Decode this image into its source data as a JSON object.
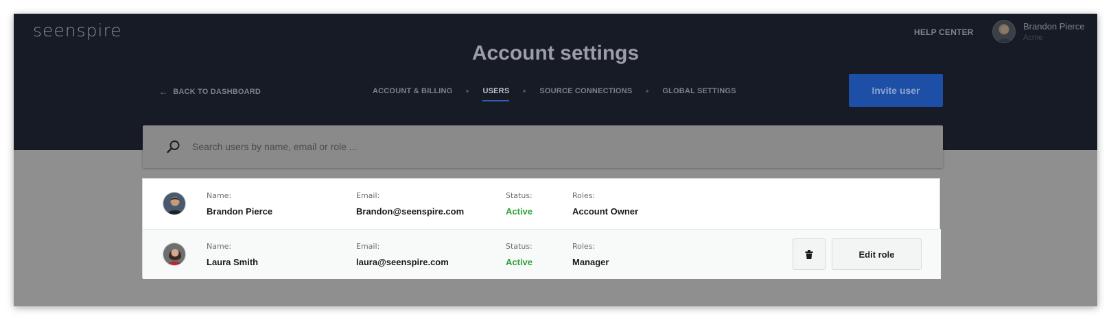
{
  "brand": {
    "logo_text": "seenspire"
  },
  "header": {
    "help_center": "HELP CENTER",
    "profile": {
      "name": "Brandon Pierce",
      "org": "Acme"
    }
  },
  "page": {
    "title": "Account settings"
  },
  "nav": {
    "back_label": "BACK TO DASHBOARD",
    "tabs": [
      {
        "label": "ACCOUNT & BILLING",
        "active": false
      },
      {
        "label": "USERS",
        "active": true
      },
      {
        "label": "SOURCE CONNECTIONS",
        "active": false
      },
      {
        "label": "GLOBAL SETTINGS",
        "active": false
      }
    ],
    "invite_label": "Invite user"
  },
  "search": {
    "placeholder": "Search users by name, email or role ..."
  },
  "users": {
    "labels": {
      "name": "Name:",
      "email": "Email:",
      "status": "Status:",
      "roles": "Roles:"
    },
    "rows": [
      {
        "name": "Brandon Pierce",
        "email": "Brandon@seenspire.com",
        "status": "Active",
        "role": "Account Owner"
      },
      {
        "name": "Laura Smith",
        "email": "laura@seenspire.com",
        "status": "Active",
        "role": "Manager",
        "edit_label": "Edit role"
      }
    ]
  },
  "colors": {
    "header_bg": "#161b26",
    "overlay_bg": "#8f8f8f",
    "accent": "#1d4fa6",
    "status_active": "#2fa33a"
  },
  "icons": {
    "back": "arrow-left-icon",
    "search": "search-icon",
    "delete": "trash-icon"
  }
}
